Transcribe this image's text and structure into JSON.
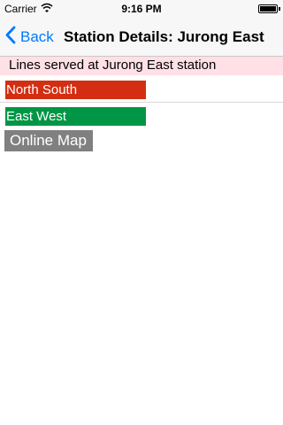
{
  "status_bar": {
    "carrier": "Carrier",
    "time": "9:16 PM",
    "icons": [
      "wifi-icon",
      "battery-icon"
    ]
  },
  "nav": {
    "back_label": "Back",
    "title": "Station Details: Jurong East",
    "back_icon": "chevron-left-icon"
  },
  "content": {
    "section_header": "Lines served at Jurong East station",
    "lines": [
      {
        "label": "North South",
        "color": "#d42e12"
      },
      {
        "label": "East West",
        "color": "#009645"
      }
    ],
    "online_map_label": "Online Map"
  },
  "colors": {
    "accent": "#007aff",
    "header_bg": "#ffe0e6",
    "map_button": "#808080"
  }
}
